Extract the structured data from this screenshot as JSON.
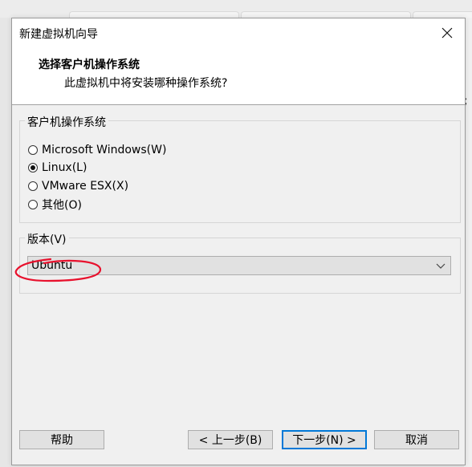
{
  "dialog": {
    "title": "新建虚拟机向导",
    "close_icon": "close-icon"
  },
  "header": {
    "title": "选择客户机操作系统",
    "subtitle": "此虚拟机中将安装哪种操作系统?"
  },
  "os_group": {
    "label": "客户机操作系统",
    "options": [
      {
        "label": "Microsoft Windows(W)",
        "checked": false
      },
      {
        "label": "Linux(L)",
        "checked": true
      },
      {
        "label": "VMware ESX(X)",
        "checked": false
      },
      {
        "label": "其他(O)",
        "checked": false
      }
    ]
  },
  "version_group": {
    "label": "版本(V)",
    "selected": "Ubuntu",
    "dropdown_icon": "chevron-down-icon"
  },
  "annotation": {
    "color": "#e8112d"
  },
  "buttons": {
    "help": "帮助",
    "back": "< 上一步(B)",
    "next": "下一步(N) >",
    "cancel": "取消"
  },
  "colors": {
    "focus_border": "#0078d7",
    "dialog_bg": "#f0f0f0",
    "header_bg": "#ffffff"
  }
}
